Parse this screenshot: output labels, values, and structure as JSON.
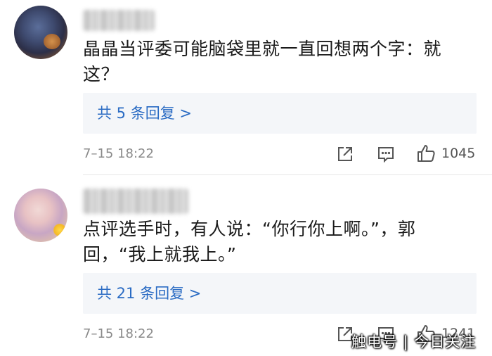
{
  "comments": [
    {
      "text": "晶晶当评委可能脑袋里就一直回想两个字：就这？",
      "replies_label": "共 5 条回复 >",
      "timestamp": "7–15 18:22",
      "like_count": "1045",
      "avatar_icon": "avatar-photo",
      "username_obscured": true
    },
    {
      "text": "点评选手时，有人说：“你行你上啊。”，郭回，“我上就我上。”",
      "replies_label": "共 21 条回复 >",
      "timestamp": "7–15 18:22",
      "like_count": "1241",
      "avatar_icon": "avatar-photo",
      "username_obscured": true
    }
  ],
  "icons": {
    "share": "share-icon",
    "comment": "comment-icon",
    "like": "thumbs-up-icon"
  },
  "watermark": "触电号 | 今日关注",
  "colors": {
    "link": "#2b6cc4",
    "reply_box": "#f4f6f9",
    "meta_text": "#8a8a8a",
    "body_text": "#1a1a1a"
  }
}
